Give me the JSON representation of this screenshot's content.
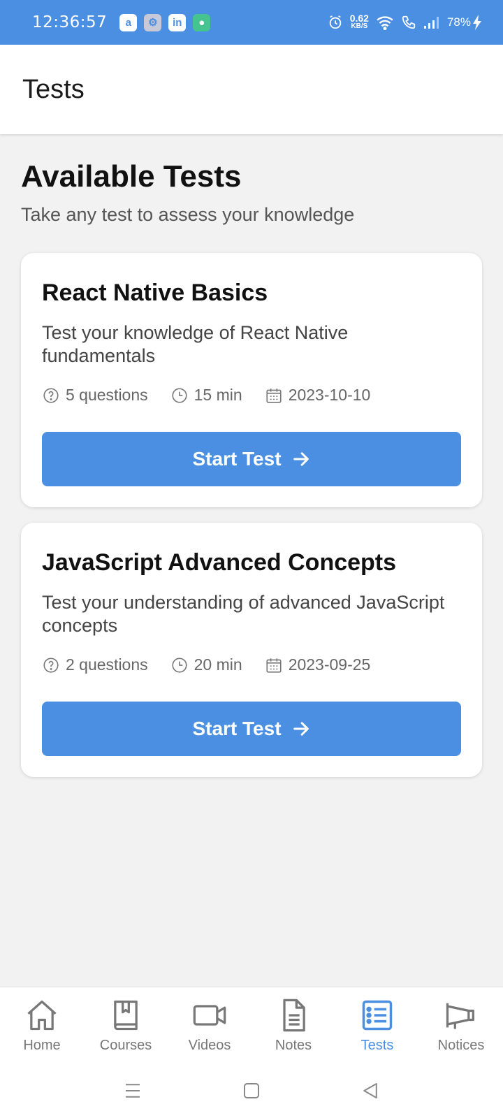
{
  "status_bar": {
    "time": "12:36:57",
    "apps": [
      "a",
      "⚙",
      "in",
      "●"
    ],
    "net_speed": "0.62",
    "net_unit": "KB/S",
    "battery": "78%"
  },
  "header": {
    "title": "Tests"
  },
  "page": {
    "title": "Available Tests",
    "subtitle": "Take any test to assess your knowledge"
  },
  "tests": [
    {
      "title": "React Native Basics",
      "description": "Test your knowledge of React Native fundamentals",
      "questions": "5 questions",
      "duration": "15 min",
      "date": "2023-10-10",
      "button_label": "Start Test"
    },
    {
      "title": "JavaScript Advanced Concepts",
      "description": "Test your understanding of advanced JavaScript concepts",
      "questions": "2 questions",
      "duration": "20 min",
      "date": "2023-09-25",
      "button_label": "Start Test"
    }
  ],
  "nav": {
    "items": [
      {
        "label": "Home",
        "icon": "home-icon"
      },
      {
        "label": "Courses",
        "icon": "book-icon"
      },
      {
        "label": "Videos",
        "icon": "video-icon"
      },
      {
        "label": "Notes",
        "icon": "document-icon"
      },
      {
        "label": "Tests",
        "icon": "list-icon",
        "active": true
      },
      {
        "label": "Notices",
        "icon": "megaphone-icon"
      }
    ]
  },
  "colors": {
    "accent": "#4a8fe2",
    "background": "#f2f2f2"
  }
}
